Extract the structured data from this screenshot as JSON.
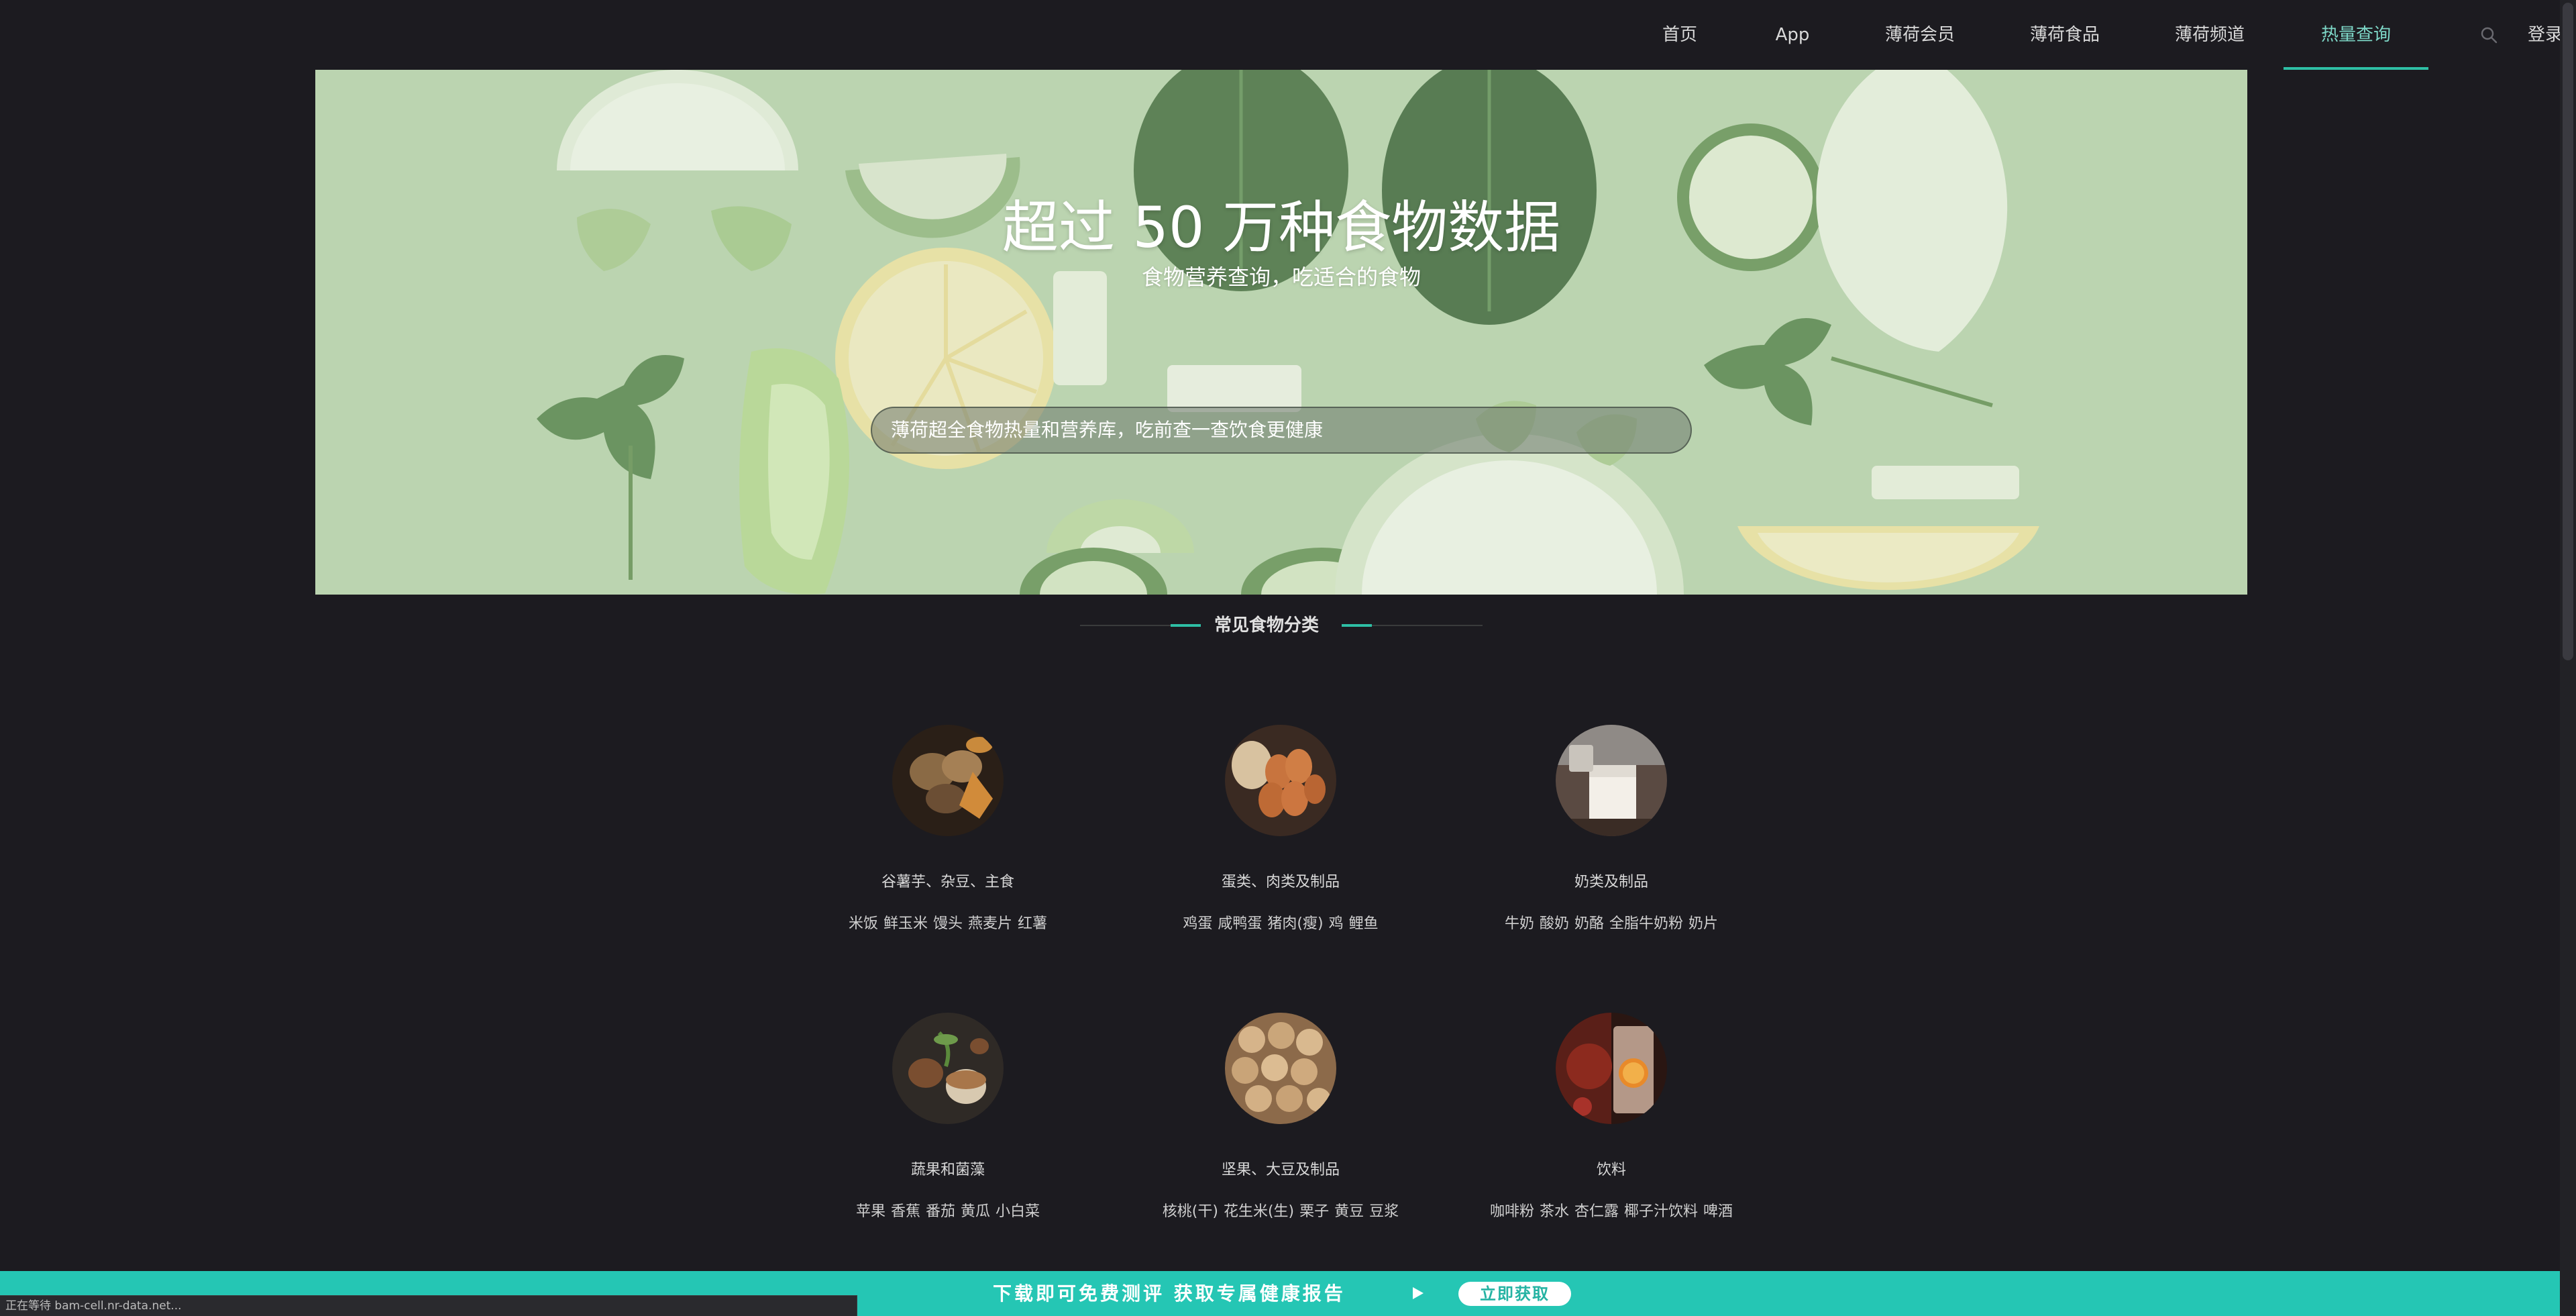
{
  "nav": {
    "items": [
      {
        "label": "首页"
      },
      {
        "label": "App"
      },
      {
        "label": "薄荷会员"
      },
      {
        "label": "薄荷食品"
      },
      {
        "label": "薄荷频道"
      },
      {
        "label": "热量查询",
        "active": true
      }
    ],
    "search_icon": "search-icon",
    "login_label": "登录"
  },
  "hero": {
    "title": "超过 50 万种食物数据",
    "subtitle": "食物营养查询，吃适合的食物",
    "search_placeholder": "薄荷超全食物热量和营养库，吃前查一查饮食更健康"
  },
  "categories_section": {
    "title": "常见食物分类",
    "items": [
      {
        "name": "谷薯芋、杂豆、主食",
        "foods": [
          "米饭",
          "鲜玉米",
          "馒头",
          "燕麦片",
          "红薯"
        ]
      },
      {
        "name": "蛋类、肉类及制品",
        "foods": [
          "鸡蛋",
          "咸鸭蛋",
          "猪肉(瘦)",
          "鸡",
          "鲤鱼"
        ]
      },
      {
        "name": "奶类及制品",
        "foods": [
          "牛奶",
          "酸奶",
          "奶酪",
          "全脂牛奶粉",
          "奶片"
        ]
      },
      {
        "name": "蔬果和菌藻",
        "foods": [
          "苹果",
          "香蕉",
          "番茄",
          "黄瓜",
          "小白菜"
        ]
      },
      {
        "name": "坚果、大豆及制品",
        "foods": [
          "核桃(干)",
          "花生米(生)",
          "栗子",
          "黄豆",
          "豆浆"
        ]
      },
      {
        "name": "饮料",
        "foods": [
          "咖啡粉",
          "茶水",
          "杏仁露",
          "椰子汁饮料",
          "啤酒"
        ]
      }
    ]
  },
  "banner": {
    "text": "下载即可免费测评  获取专属健康报告",
    "button_label": "立即获取"
  },
  "status_bar": {
    "text": "正在等待 bam-cell.nr-data.net..."
  },
  "colors": {
    "background": "#1c1b20",
    "accent": "#2ebfa5",
    "banner": "#25c6b4"
  }
}
